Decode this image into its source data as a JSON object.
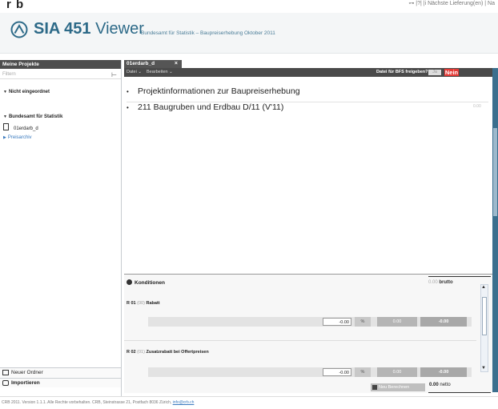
{
  "top": {
    "logo_text": "r b",
    "right_text": "⊶  |?|  |i    Nächste Lieferung(en) | Na"
  },
  "header": {
    "app_name_bold": "SIA 451",
    "app_name_rest": " Viewer",
    "subtitle": "Bundesamt für Statistik – Baupreiserhebung Oktober 2011"
  },
  "sidebar": {
    "title": "Meine Projekte",
    "filter_placeholder": "Filtern",
    "groups": {
      "unassigned": "Nicht eingeordnet",
      "bfs": "Bundesamt für Statistik",
      "bfs_file": "01erdarb_d",
      "archive": "Preisarchiv"
    },
    "new_folder": "Neuer Ordner",
    "import": "Importieren"
  },
  "main": {
    "tab_label": "01erdarb_d",
    "tab_close": "×",
    "menu_file": "Datei ⌄",
    "menu_edit": "Bearbeiten ⌄",
    "release_label": "Datei für BFS freigeben?",
    "release_yes": "Ja",
    "release_no": "Nein",
    "rows": [
      {
        "text": "Projektinformationen zur Baupreiserhebung",
        "value": ""
      },
      {
        "text": "211 Baugruben und Erdbau D/11 (V'11)",
        "value": "0.00"
      }
    ]
  },
  "conditions": {
    "title": "Konditionen",
    "total_top": "0.00",
    "total_top_unit": "brutto",
    "items": [
      {
        "code": "R 01",
        "idx": "(00)",
        "name": "Rabatt",
        "input": "-0.00",
        "pct": "%",
        "amount": "0.00",
        "result": "-0.00"
      },
      {
        "code": "R 02",
        "idx": "(01)",
        "name": "Zusatzrabatt bei Offertpreisen",
        "input": "-0.00",
        "pct": "%",
        "amount": "0.00",
        "result": "-0.00"
      }
    ],
    "recalc_label": "Neu Berechnen",
    "total_bottom": "0.00",
    "total_bottom_unit": "netto"
  },
  "footer": {
    "text": "CRB 2011. Version 1.1.1. Alle Rechte vorbehalten. CRB, Steinstrasse 21, Postfach 8036 Zürich,",
    "email": "info@crb.ch"
  },
  "colors": {
    "brand_blue": "#2d6a88",
    "dark_bar": "#4a4a4a",
    "nein_red": "#e53935",
    "right_scroll": "#3b6f8e"
  }
}
